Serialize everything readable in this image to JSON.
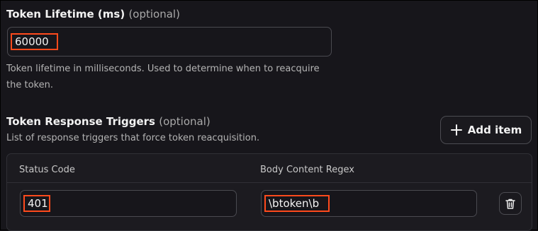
{
  "token_lifetime": {
    "label": "Token Lifetime (ms)",
    "optional": "(optional)",
    "value": "60000",
    "help_line1": "Token lifetime in milliseconds. Used to determine when to reacquire",
    "help_line2": "the token."
  },
  "token_response_triggers": {
    "label": "Token Response Triggers",
    "optional": "(optional)",
    "help": "List of response triggers that force token reacquisition.",
    "add_button_label": "Add item",
    "add_icon": "plus-icon",
    "columns": {
      "status_code": "Status Code",
      "body_content_regex": "Body Content Regex"
    },
    "rows": [
      {
        "status_code": "401",
        "body_content_regex": "\\btoken\\b",
        "delete_icon": "trash-icon"
      }
    ]
  },
  "colors": {
    "background": "#17161b",
    "highlight": "#ff4a1c",
    "border": "#4a4a50",
    "text": "#ececec",
    "muted_text": "#b4b4b4"
  }
}
